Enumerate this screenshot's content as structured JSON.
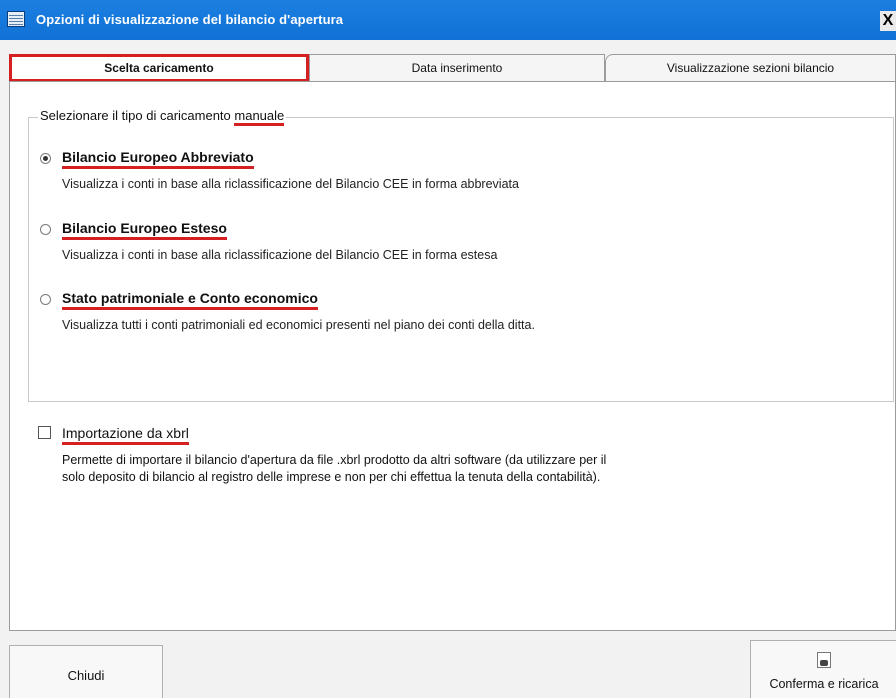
{
  "window": {
    "title": "Opzioni di visualizzazione del bilancio d'apertura",
    "close_label": "X"
  },
  "tabs": [
    {
      "label": "Scelta caricamento",
      "active": true
    },
    {
      "label": "Data inserimento",
      "active": false
    },
    {
      "label": "Visualizzazione sezioni bilancio",
      "active": false
    }
  ],
  "group": {
    "legend_prefix": "Selezionare il tipo di caricamento ",
    "legend_highlight": "manuale"
  },
  "options": [
    {
      "title": "Bilancio Europeo Abbreviato",
      "description": "Visualizza i conti in base alla riclassificazione del Bilancio CEE in forma abbreviata",
      "selected": true
    },
    {
      "title": "Bilancio Europeo Esteso",
      "description": "Visualizza i conti in base alla riclassificazione del Bilancio CEE in forma estesa",
      "selected": false
    },
    {
      "title": "Stato patrimoniale e Conto economico",
      "description": "Visualizza tutti i conti patrimoniali ed economici presenti nel piano dei conti della ditta.",
      "selected": false
    }
  ],
  "import": {
    "label": "Importazione da xbrl",
    "checked": false,
    "description_line1": "Permette di importare il bilancio d'apertura da file .xbrl prodotto da altri software (da utilizzare per il",
    "description_line2": "solo deposito di bilancio al registro delle imprese e non per chi effettua la tenuta della contabilità)."
  },
  "buttons": {
    "close_label": "Chiudi",
    "confirm_label": "Conferma e ricarica"
  },
  "colors": {
    "titlebar": "#1171d6",
    "highlight": "#d42020"
  }
}
